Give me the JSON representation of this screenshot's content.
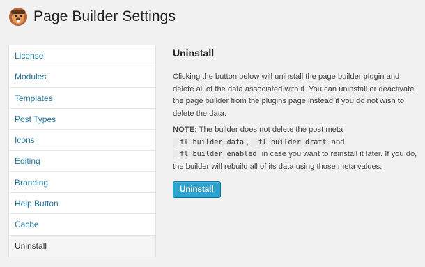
{
  "header": {
    "title": "Page Builder Settings",
    "logo_icon": "beaver-logo-icon"
  },
  "nav": {
    "items": [
      {
        "label": "License"
      },
      {
        "label": "Modules"
      },
      {
        "label": "Templates"
      },
      {
        "label": "Post Types"
      },
      {
        "label": "Icons"
      },
      {
        "label": "Editing"
      },
      {
        "label": "Branding"
      },
      {
        "label": "Help Button"
      },
      {
        "label": "Cache"
      },
      {
        "label": "Uninstall",
        "active": true
      }
    ]
  },
  "uninstall": {
    "title": "Uninstall",
    "description": "Clicking the button below will uninstall the page builder plugin and delete all of the data associated with it. You can uninstall or deactivate the page builder from the plugins page instead if you do not wish to delete the data.",
    "note": {
      "label": "NOTE:",
      "text1": " The builder does not delete the post meta ",
      "code1": "_fl_builder_data",
      "text2": ", ",
      "code2": "_fl_builder_draft",
      "text3": " and ",
      "code3": "_fl_builder_enabled",
      "text4": " in case you want to reinstall it later. If you do, the builder will rebuild all of its data using those meta values."
    },
    "button_label": "Uninstall"
  },
  "colors": {
    "link": "#21759b",
    "button": "#2ea2cc",
    "background": "#f1f1f1"
  }
}
